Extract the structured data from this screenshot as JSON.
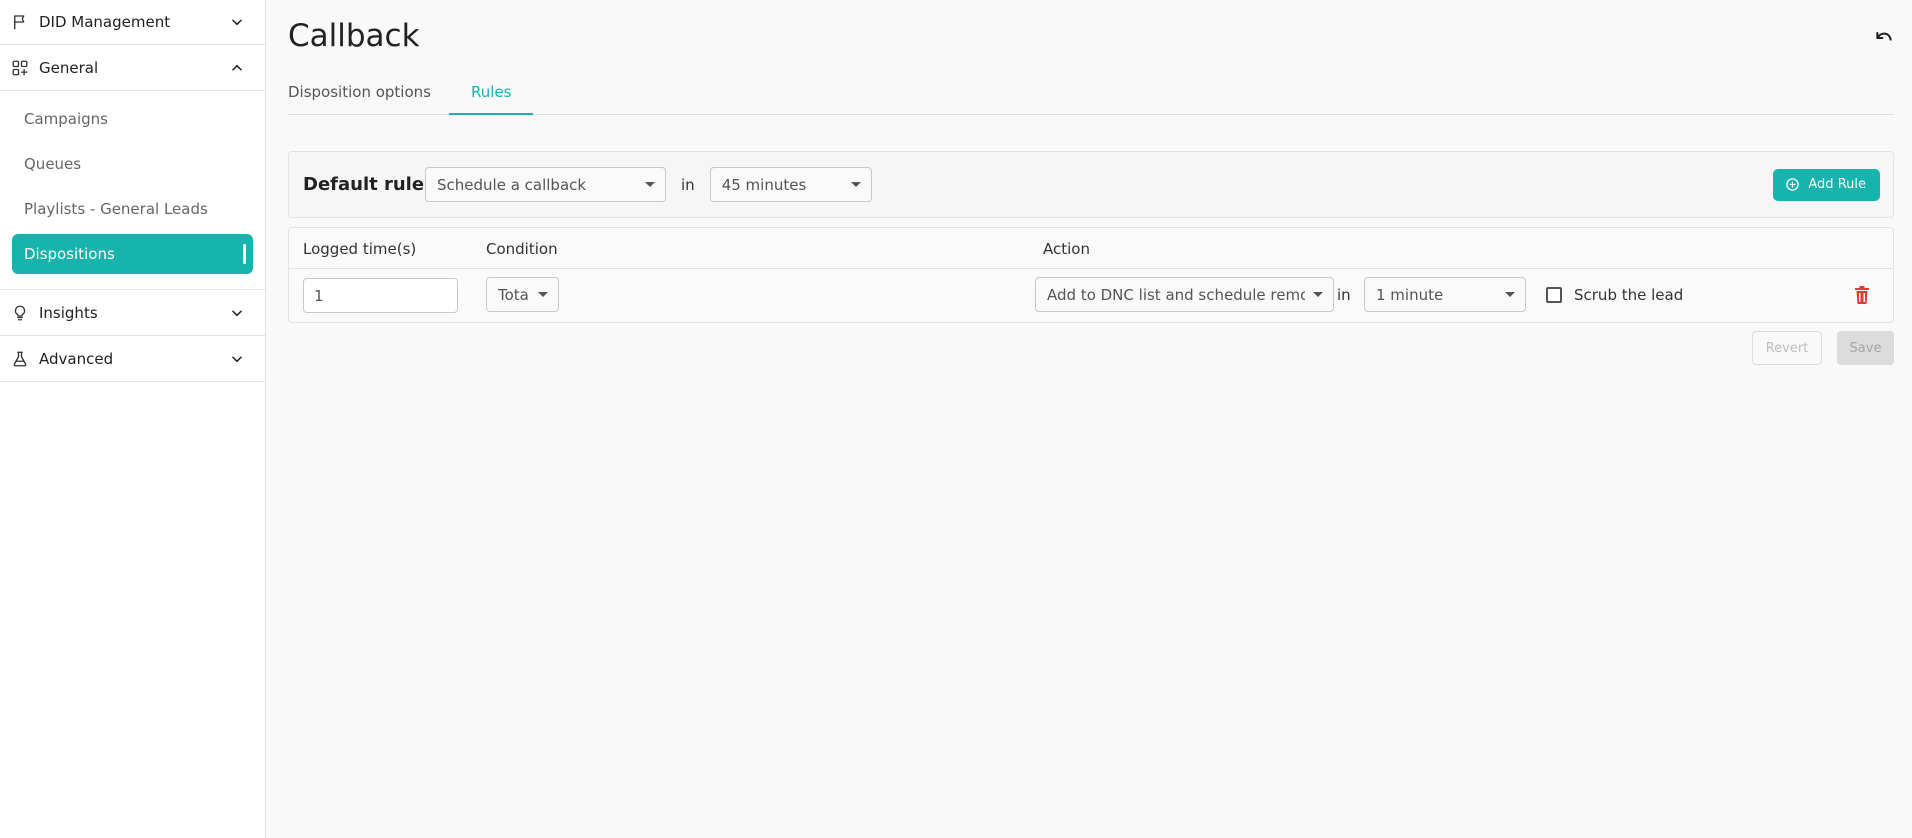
{
  "sidebar": {
    "did_management": {
      "label": "DID Management",
      "icon": "flag-icon",
      "expanded": false
    },
    "general": {
      "label": "General",
      "icon": "apps-add-icon",
      "expanded": true,
      "items": [
        {
          "label": "Campaigns",
          "active": false
        },
        {
          "label": "Queues",
          "active": false
        },
        {
          "label": "Playlists - General Leads",
          "active": false
        },
        {
          "label": "Dispositions",
          "active": true
        }
      ]
    },
    "insights": {
      "label": "Insights",
      "icon": "lightbulb-icon",
      "expanded": false
    },
    "advanced": {
      "label": "Advanced",
      "icon": "flask-icon",
      "expanded": false
    }
  },
  "page": {
    "title": "Callback",
    "undo_icon": "undo-icon"
  },
  "tabs": [
    {
      "label": "Disposition options",
      "active": false
    },
    {
      "label": "Rules",
      "active": true
    }
  ],
  "default_rule": {
    "label": "Default rule",
    "action": "Schedule a callback",
    "in_label": "in",
    "delay": "45 minutes",
    "add_rule_label": "Add Rule"
  },
  "rules_table": {
    "headers": {
      "logged_times": "Logged time(s)",
      "condition": "Condition",
      "action": "Action"
    },
    "rows": [
      {
        "logged_times": "1",
        "condition": "Total",
        "action": "Add to DNC list and schedule removal",
        "in_label": "in",
        "delay": "1 minute",
        "scrub_label": "Scrub the lead",
        "scrub_checked": false
      }
    ]
  },
  "footer": {
    "revert_label": "Revert",
    "save_label": "Save"
  },
  "colors": {
    "accent": "#17b3ad",
    "danger": "#e53935"
  }
}
